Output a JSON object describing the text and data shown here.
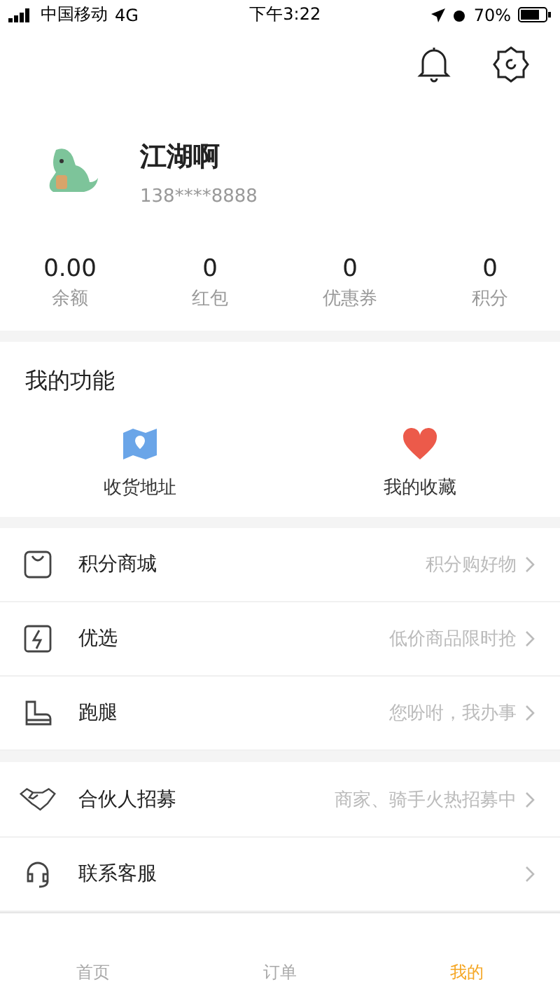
{
  "status_bar": {
    "carrier": "中国移动",
    "network": "4G",
    "time": "下午3:22",
    "battery": "70%"
  },
  "profile": {
    "name": "江湖啊",
    "phone": "138****8888"
  },
  "stats": [
    {
      "value": "0.00",
      "label": "余额"
    },
    {
      "value": "0",
      "label": "红包"
    },
    {
      "value": "0",
      "label": "优惠券"
    },
    {
      "value": "0",
      "label": "积分"
    }
  ],
  "functions": {
    "title": "我的功能",
    "items": [
      {
        "kind": "map",
        "label": "收货地址"
      },
      {
        "kind": "heart",
        "label": "我的收藏"
      }
    ]
  },
  "menu_groups": [
    [
      {
        "kind": "bag",
        "label": "积分商城",
        "hint": "积分购好物"
      },
      {
        "kind": "bolt",
        "label": "优选",
        "hint": "低价商品限时抢"
      },
      {
        "kind": "boot",
        "label": "跑腿",
        "hint": "您吩咐，我办事"
      }
    ],
    [
      {
        "kind": "handshake",
        "label": "合伙人招募",
        "hint": "商家、骑手火热招募中"
      },
      {
        "kind": "headset",
        "label": "联系客服"
      }
    ]
  ],
  "tab_bar": [
    {
      "label": "首页",
      "selected": false
    },
    {
      "label": "订单",
      "selected": false
    },
    {
      "label": "我的",
      "selected": true
    }
  ]
}
